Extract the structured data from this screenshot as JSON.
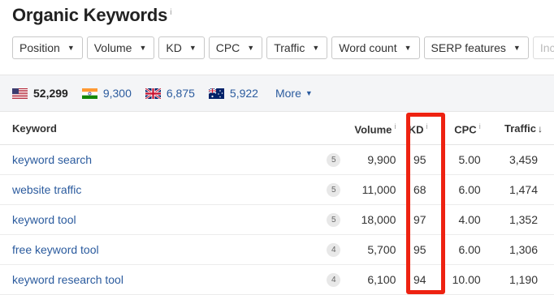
{
  "title": "Organic Keywords",
  "title_info": "i",
  "filters": [
    {
      "label": "Position"
    },
    {
      "label": "Volume"
    },
    {
      "label": "KD"
    },
    {
      "label": "CPC"
    },
    {
      "label": "Traffic"
    },
    {
      "label": "Word count"
    },
    {
      "label": "SERP features"
    },
    {
      "label": "Incl"
    }
  ],
  "countries": [
    {
      "flag": "us-flag",
      "count": "52,299"
    },
    {
      "flag": "india-flag",
      "count": "9,300"
    },
    {
      "flag": "uk-flag",
      "count": "6,875"
    },
    {
      "flag": "australia-flag",
      "count": "5,922"
    }
  ],
  "more_label": "More",
  "columns": {
    "keyword": "Keyword",
    "volume": "Volume",
    "kd": "KD",
    "cpc": "CPC",
    "traffic": "Traffic",
    "info": "i",
    "sort_arrow": "↓"
  },
  "rows": [
    {
      "keyword": "keyword search",
      "words": "5",
      "volume": "9,900",
      "kd": "95",
      "cpc": "5.00",
      "traffic": "3,459"
    },
    {
      "keyword": "website traffic",
      "words": "5",
      "volume": "11,000",
      "kd": "68",
      "cpc": "6.00",
      "traffic": "1,474"
    },
    {
      "keyword": "keyword tool",
      "words": "5",
      "volume": "18,000",
      "kd": "97",
      "cpc": "4.00",
      "traffic": "1,352"
    },
    {
      "keyword": "free keyword tool",
      "words": "4",
      "volume": "5,700",
      "kd": "95",
      "cpc": "6.00",
      "traffic": "1,306"
    },
    {
      "keyword": "keyword research tool",
      "words": "4",
      "volume": "6,100",
      "kd": "94",
      "cpc": "10.00",
      "traffic": "1,190"
    }
  ],
  "colors": {
    "link": "#2b5b9e",
    "highlight": "#ee2211",
    "band": "#f4f5f7"
  }
}
